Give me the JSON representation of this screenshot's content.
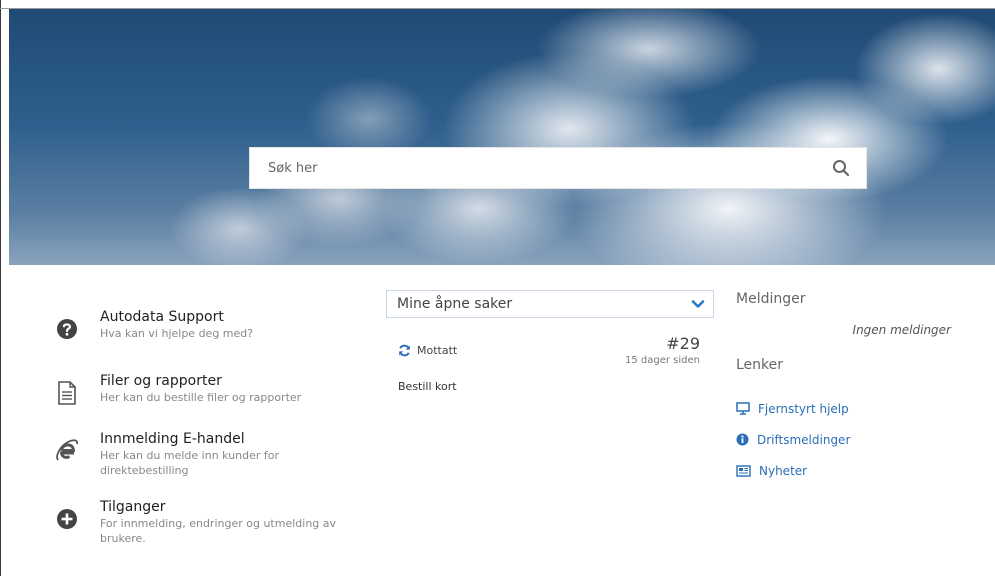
{
  "search": {
    "placeholder": "Søk her"
  },
  "shortcuts": [
    {
      "icon": "question-circle-icon",
      "title": "Autodata Support",
      "desc": "Hva kan vi hjelpe deg med?"
    },
    {
      "icon": "document-icon",
      "title": "Filer og rapporter",
      "desc": "Her kan du bestille filer og rapporter"
    },
    {
      "icon": "internet-explorer-icon",
      "title": "Innmelding E-handel",
      "desc1": "Her kan du melde inn kunder for",
      "desc2": "direktebestilling"
    },
    {
      "icon": "plus-circle-icon",
      "title": "Tilganger",
      "desc1": "For innmelding, endringer og utmelding av",
      "desc2": "brukere."
    }
  ],
  "cases": {
    "selected": "Mine åpne saker",
    "items": [
      {
        "status": "Mottatt",
        "number": "#29",
        "age": "15 dager siden",
        "title": "Bestill kort"
      }
    ]
  },
  "messages": {
    "heading": "Meldinger",
    "empty": "Ingen meldinger"
  },
  "links": {
    "heading": "Lenker",
    "items": [
      {
        "icon": "monitor-icon",
        "label": "Fjernstyrt hjelp"
      },
      {
        "icon": "info-circle-icon",
        "label": "Driftsmeldinger"
      },
      {
        "icon": "newspaper-icon",
        "label": "Nyheter"
      }
    ]
  },
  "colors": {
    "link": "#2a6fb5",
    "accent": "#2a6fb5",
    "hero_sky": "#1f4a74"
  }
}
